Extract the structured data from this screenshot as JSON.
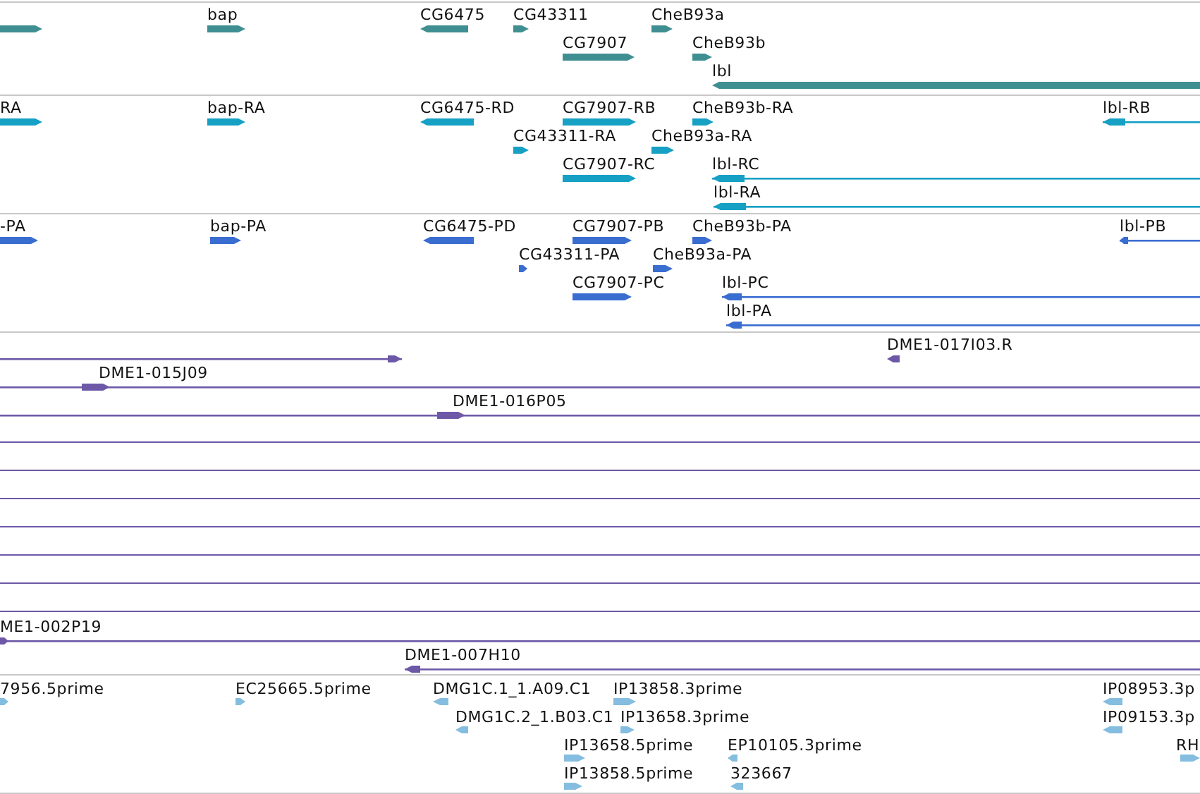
{
  "tracks": [
    {
      "kind": "genes",
      "color": "#3f8f92",
      "features": [
        {
          "reverse": false
        },
        {
          "label": "bap",
          "reverse": false
        },
        {
          "label": "CG6475",
          "reverse": true
        },
        {
          "label": "CG43311",
          "reverse": false
        },
        {
          "label": "CheB93a",
          "reverse": false
        },
        {
          "label": "CG7907",
          "reverse": false
        },
        {
          "label": "CheB93b",
          "reverse": false
        },
        {
          "label": "lbl",
          "reverse": true
        }
      ]
    },
    {
      "kind": "transcripts",
      "color": "#15a0c4",
      "features": [
        {
          "label": "RA",
          "reverse": false
        },
        {
          "label": "bap-RA",
          "reverse": false
        },
        {
          "label": "CG6475-RD",
          "reverse": true
        },
        {
          "label": "CG7907-RB",
          "reverse": false
        },
        {
          "label": "CheB93b-RA",
          "reverse": false
        },
        {
          "label": "lbl-RB",
          "reverse": true
        },
        {
          "label": "CG43311-RA",
          "reverse": false
        },
        {
          "label": "CheB93a-RA",
          "reverse": false
        },
        {
          "label": "CG7907-RC",
          "reverse": false
        },
        {
          "label": "lbl-RC",
          "reverse": true
        },
        {
          "label": "lbl-RA",
          "reverse": true
        }
      ]
    },
    {
      "kind": "proteins",
      "color": "#3a6dd0",
      "features": [
        {
          "label": "-PA",
          "reverse": false
        },
        {
          "label": "bap-PA",
          "reverse": false
        },
        {
          "label": "CG6475-PD",
          "reverse": true
        },
        {
          "label": "CG7907-PB",
          "reverse": false
        },
        {
          "label": "CheB93b-PA",
          "reverse": false
        },
        {
          "label": "lbl-PB",
          "reverse": true
        },
        {
          "label": "CG43311-PA",
          "reverse": false
        },
        {
          "label": "CheB93a-PA",
          "reverse": false
        },
        {
          "label": "CG7907-PC",
          "reverse": false
        },
        {
          "label": "lbl-PC",
          "reverse": true
        },
        {
          "label": "lbl-PA",
          "reverse": true
        }
      ]
    },
    {
      "kind": "clones",
      "color": "#6d58a8",
      "features": [
        {
          "reverse": false
        },
        {
          "label": "DME1-017I03.R",
          "reverse": true
        },
        {
          "label": "DME1-015J09",
          "reverse": false
        },
        {
          "label": "DME1-016P05",
          "reverse": false
        },
        {
          "label": "ME1-002P19",
          "reverse": false
        },
        {
          "label": "DME1-007H10",
          "reverse": true
        }
      ]
    },
    {
      "kind": "ests",
      "color": "#84bde0",
      "features": [
        {
          "label": "7956.5prime",
          "reverse": false
        },
        {
          "label": "EC25665.5prime",
          "reverse": false
        },
        {
          "label": "DMG1C.1_1.A09.C1",
          "reverse": true
        },
        {
          "label": "IP13858.3prime",
          "reverse": false
        },
        {
          "label": "IP08953.3p",
          "reverse": true
        },
        {
          "label": "DMG1C.2_1.B03.C1",
          "reverse": true
        },
        {
          "label": "IP13658.3prime",
          "reverse": false
        },
        {
          "label": "IP09153.3p",
          "reverse": true
        },
        {
          "label": "IP13658.5prime",
          "reverse": false
        },
        {
          "label": "EP10105.3prime",
          "reverse": true
        },
        {
          "label": "RH",
          "reverse": false
        },
        {
          "label": "IP13858.5prime",
          "reverse": false
        },
        {
          "label": "323667",
          "reverse": true
        }
      ]
    }
  ]
}
